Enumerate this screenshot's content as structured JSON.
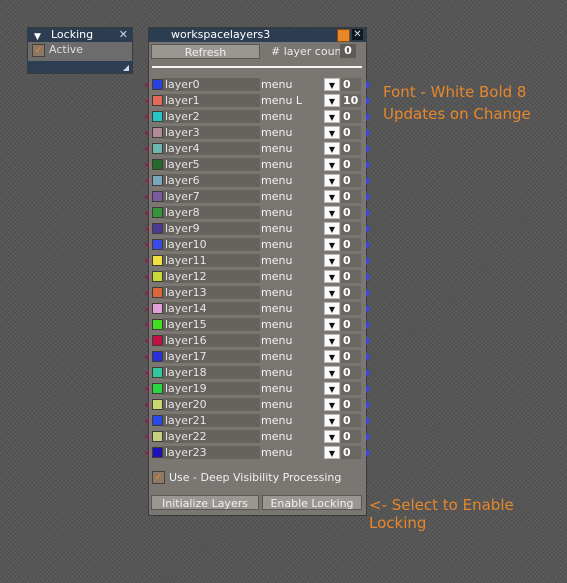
{
  "locking_node": {
    "title": "Locking",
    "active_label": "Active",
    "active_checked": true
  },
  "panel": {
    "title": "workspacelayers3",
    "refresh_label": "Refresh",
    "layer_count_label": "# layer count",
    "layer_count_value": "0",
    "layers": [
      {
        "name": "layer0",
        "menu": "menu",
        "value": "0",
        "color": "#2742e0"
      },
      {
        "name": "layer1",
        "menu": "menu L",
        "value": "10",
        "color": "#e06a5a"
      },
      {
        "name": "layer2",
        "menu": "menu",
        "value": "0",
        "color": "#27c4c8"
      },
      {
        "name": "layer3",
        "menu": "menu",
        "value": "0",
        "color": "#b08a9a"
      },
      {
        "name": "layer4",
        "menu": "menu",
        "value": "0",
        "color": "#6ab8b0"
      },
      {
        "name": "layer5",
        "menu": "menu",
        "value": "0",
        "color": "#236a2c"
      },
      {
        "name": "layer6",
        "menu": "menu",
        "value": "0",
        "color": "#78a8c0"
      },
      {
        "name": "layer7",
        "menu": "menu",
        "value": "0",
        "color": "#7a5aa0"
      },
      {
        "name": "layer8",
        "menu": "menu",
        "value": "0",
        "color": "#34943c"
      },
      {
        "name": "layer9",
        "menu": "menu",
        "value": "0",
        "color": "#4a3a90"
      },
      {
        "name": "layer10",
        "menu": "menu",
        "value": "0",
        "color": "#3a4ae8"
      },
      {
        "name": "layer11",
        "menu": "menu",
        "value": "0",
        "color": "#f0e040"
      },
      {
        "name": "layer12",
        "menu": "menu",
        "value": "0",
        "color": "#c8d838"
      },
      {
        "name": "layer13",
        "menu": "menu",
        "value": "0",
        "color": "#d8683a"
      },
      {
        "name": "layer14",
        "menu": "menu",
        "value": "0",
        "color": "#e0a0d8"
      },
      {
        "name": "layer15",
        "menu": "menu",
        "value": "0",
        "color": "#40e020"
      },
      {
        "name": "layer16",
        "menu": "menu",
        "value": "0",
        "color": "#c01048"
      },
      {
        "name": "layer17",
        "menu": "menu",
        "value": "0",
        "color": "#2a30d8"
      },
      {
        "name": "layer18",
        "menu": "menu",
        "value": "0",
        "color": "#30c8a0"
      },
      {
        "name": "layer19",
        "menu": "menu",
        "value": "0",
        "color": "#28d840"
      },
      {
        "name": "layer20",
        "menu": "menu",
        "value": "0",
        "color": "#c8d870"
      },
      {
        "name": "layer21",
        "menu": "menu",
        "value": "0",
        "color": "#2848e8"
      },
      {
        "name": "layer22",
        "menu": "menu",
        "value": "0",
        "color": "#c8d080"
      },
      {
        "name": "layer23",
        "menu": "menu",
        "value": "0",
        "color": "#2010b8"
      }
    ],
    "deep_visibility_label": "Use - Deep Visibility Processing",
    "deep_visibility_checked": true,
    "initialize_label": "Initialize Layers",
    "enable_locking_label": "Enable Locking"
  },
  "annotations": {
    "font_note": "Font - White Bold 8",
    "updates_note": "Updates on Change",
    "select_note": "<- Select to Enable Locking"
  },
  "colors": {
    "accent": "#e8872a",
    "titlebar": "#2c3d52",
    "panel_bg": "#7a7672"
  }
}
